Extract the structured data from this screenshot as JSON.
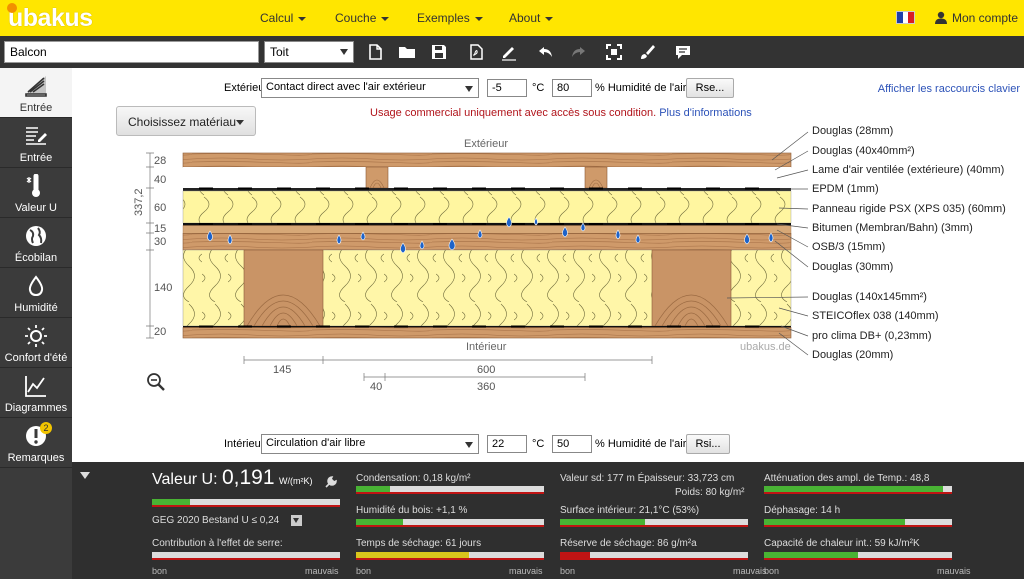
{
  "app": {
    "logo": "ubakus"
  },
  "nav": [
    {
      "label": "Calcul"
    },
    {
      "label": "Couche"
    },
    {
      "label": "Exemples"
    },
    {
      "label": "About"
    }
  ],
  "account": {
    "label": "Mon compte"
  },
  "toolbar": {
    "name_value": "Balcon",
    "type_value": "Toit",
    "tools": [
      "new-file-icon",
      "open-folder-icon",
      "save-icon",
      "pdf-export-icon",
      "sign-icon",
      "undo-icon",
      "redo-icon",
      "fullscreen-icon",
      "brush-icon",
      "comment-icon"
    ]
  },
  "sidebar": {
    "items": [
      {
        "label": "Entrée",
        "icon": "layer-input-icon"
      },
      {
        "label": "Entrée",
        "icon": "list-input-icon"
      },
      {
        "label": "Valeur U",
        "icon": "thermometer-icon"
      },
      {
        "label": "Écobilan",
        "icon": "globe-icon"
      },
      {
        "label": "Humidité",
        "icon": "droplet-icon"
      },
      {
        "label": "Confort d'été",
        "icon": "sun-icon"
      },
      {
        "label": "Diagrammes",
        "icon": "chart-icon"
      },
      {
        "label": "Remarques",
        "icon": "alert-icon",
        "badge": "2"
      }
    ]
  },
  "exterior": {
    "label": "Extérieur",
    "select": "Contact direct avec l'air extérieur",
    "temp": "-5",
    "temp_unit": "°C",
    "humidity": "80",
    "humidity_label": "% Humidité de l'air",
    "button": "Rse..."
  },
  "interior": {
    "label": "Intérieur",
    "select": "Circulation d'air libre",
    "temp": "22",
    "temp_unit": "°C",
    "humidity": "50",
    "humidity_label": "% Humidité de l'air",
    "button": "Rsi..."
  },
  "material_button": "Choisissez matériau",
  "notice": {
    "text": "Usage commercial uniquement avec accès sous condition.",
    "link": "Plus d'informations"
  },
  "shortcut_link": "Afficher les raccourcis clavier",
  "diagram": {
    "top_label": "Extérieur",
    "bottom_label": "Intérieur",
    "watermark": "ubakus.de",
    "total_thickness": "337,2",
    "layer_thicknesses": [
      "28",
      "40",
      "60",
      "15",
      "30",
      "140",
      "20"
    ],
    "dims_bottom": [
      "145",
      "600",
      "40",
      "360"
    ],
    "colors": {
      "wood": "#c99466",
      "wood_dark": "#9c6b43",
      "insulation": "#fff5a0",
      "membrane": "#111111",
      "drop": "#1565c0"
    }
  },
  "layers": [
    "Douglas (28mm)",
    "Douglas (40x40mm²)",
    "Lame d'air ventilée (extérieure) (40mm)",
    "EPDM (1mm)",
    "Panneau rigide PSX (XPS 035) (60mm)",
    "Bitumen (Membran/Bahn) (3mm)",
    "OSB/3 (15mm)",
    "Douglas (30mm)",
    "Douglas (140x145mm²)",
    "STEICOflex 038 (140mm)",
    "pro clima DB+ (0,23mm)",
    "Douglas (20mm)"
  ],
  "results": {
    "u_label": "Valeur U:",
    "u_value": "0,191",
    "u_unit": "W/(m²K)",
    "u_fill": 0.2,
    "geg": "GEG 2020 Bestand U ≤ 0,24",
    "greenhouse": "Contribution à l'effet de serre:",
    "scale_good": "bon",
    "scale_bad": "mauvais",
    "cells": [
      {
        "text": "Condensation: 0,18 kg/m²",
        "fill": 0.18,
        "color": "#49b334"
      },
      {
        "text": "Humidité du bois: +1,1 %",
        "fill": 0.25,
        "color": "#49b334"
      },
      {
        "text": "Temps de séchage: 61 jours",
        "fill": 0.6,
        "color": "#d9c51c"
      },
      {
        "text": "Valeur sd: 177 m   Épaisseur: 33,723 cm",
        "extra": "Poids: 80 kg/m²",
        "fill": 0,
        "color": "#49b334"
      },
      {
        "text": "Surface intérieur: 21,1°C (53%)",
        "fill": 0.45,
        "color": "#49b334"
      },
      {
        "text": "Réserve de séchage: 86 g/m²a",
        "fill": 0.16,
        "color": "#c01414"
      },
      {
        "text": "Atténuation des ampl. de Temp.: 48,8",
        "fill": 0.95,
        "color": "#49b334"
      },
      {
        "text": "Déphasage: 14 h",
        "fill": 0.75,
        "color": "#49b334"
      },
      {
        "text": "Capacité de chaleur int.: 59 kJ/m²K",
        "fill": 0.5,
        "color": "#49b334"
      }
    ]
  }
}
